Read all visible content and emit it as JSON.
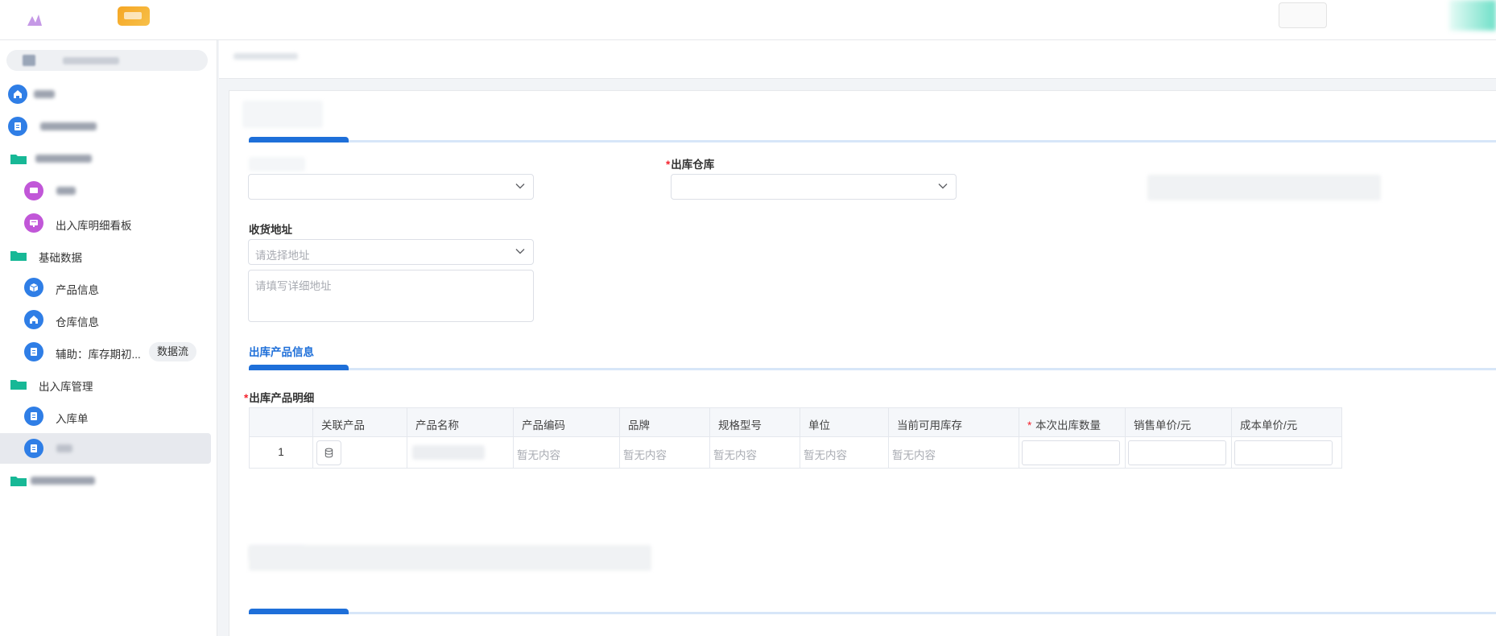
{
  "sidebar": {
    "items": [
      {
        "label": "出入库明细看板"
      },
      {
        "label": "基础数据"
      },
      {
        "label": "产品信息"
      },
      {
        "label": "仓库信息"
      },
      {
        "label": "辅助：库存期初...",
        "tag": "数据流"
      },
      {
        "label": "出入库管理"
      },
      {
        "label": "入库单"
      }
    ]
  },
  "form": {
    "warehouse": {
      "required_mark": "*",
      "label": "出库仓库"
    },
    "address": {
      "label": "收货地址",
      "select_placeholder": "请选择地址",
      "detail_placeholder": "请填写详细地址"
    }
  },
  "products_section": {
    "title": "出库产品信息",
    "detail_required_mark": "*",
    "detail_label": "出库产品明细",
    "table": {
      "headers": [
        "关联产品",
        "产品名称",
        "产品编码",
        "品牌",
        "规格型号",
        "单位",
        "当前可用库存",
        "本次出库数量",
        "销售单价/元",
        "成本单价/元"
      ],
      "required_mark": "*",
      "row": {
        "index": "1",
        "code": "暂无内容",
        "brand": "暂无内容",
        "spec": "暂无内容",
        "unit": "暂无内容",
        "stock": "暂无内容"
      }
    }
  },
  "colors": {
    "primary": "#1e6fd9",
    "required": "#f5222d",
    "sidebar_icon_blue": "#2f7ee6",
    "sidebar_icon_purple": "#c157d8",
    "folder_green": "#17b896"
  },
  "icons": [
    "home-icon",
    "doc-icon",
    "folder-icon",
    "board-icon",
    "box-icon",
    "chevron-down-icon",
    "database-icon"
  ]
}
